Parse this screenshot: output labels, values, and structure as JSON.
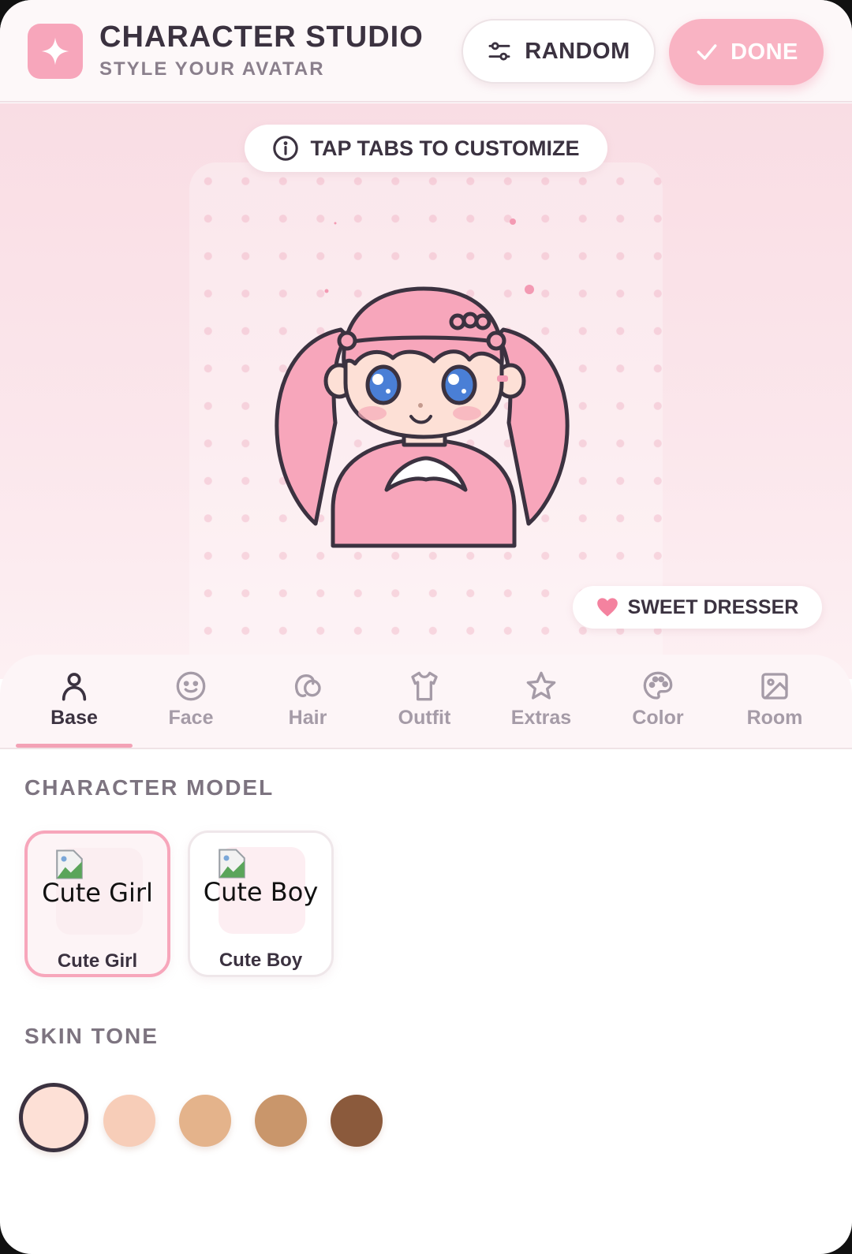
{
  "header": {
    "title": "CHARACTER STUDIO",
    "subtitle": "STYLE YOUR AVATAR",
    "random_label": "RANDOM",
    "done_label": "DONE"
  },
  "stage": {
    "hint": "TAP TABS TO CUSTOMIZE",
    "badge": "SWEET DRESSER"
  },
  "tabs": [
    {
      "label": "Base",
      "icon": "person-icon",
      "active": true
    },
    {
      "label": "Face",
      "icon": "smiley-icon",
      "active": false
    },
    {
      "label": "Hair",
      "icon": "hair-icon",
      "active": false
    },
    {
      "label": "Outfit",
      "icon": "shirt-icon",
      "active": false
    },
    {
      "label": "Extras",
      "icon": "star-icon",
      "active": false
    },
    {
      "label": "Color",
      "icon": "palette-icon",
      "active": false
    },
    {
      "label": "Room",
      "icon": "image-icon",
      "active": false
    }
  ],
  "panel": {
    "model_title": "CHARACTER MODEL",
    "models": [
      {
        "alt": "Cute Girl",
        "label": "Cute Girl",
        "selected": true
      },
      {
        "alt": "Cute Boy",
        "label": "Cute Boy",
        "selected": false
      }
    ],
    "skin_title": "SKIN TONE",
    "skin_tones": [
      {
        "color": "#fde0d6",
        "selected": true
      },
      {
        "color": "#f7cdb8",
        "selected": false
      },
      {
        "color": "#e4b38b",
        "selected": false
      },
      {
        "color": "#c9966b",
        "selected": false
      },
      {
        "color": "#8b5a3c",
        "selected": false
      }
    ]
  },
  "colors": {
    "accent": "#f7a6bb",
    "text": "#3b3240",
    "muted": "#a59ba7"
  }
}
